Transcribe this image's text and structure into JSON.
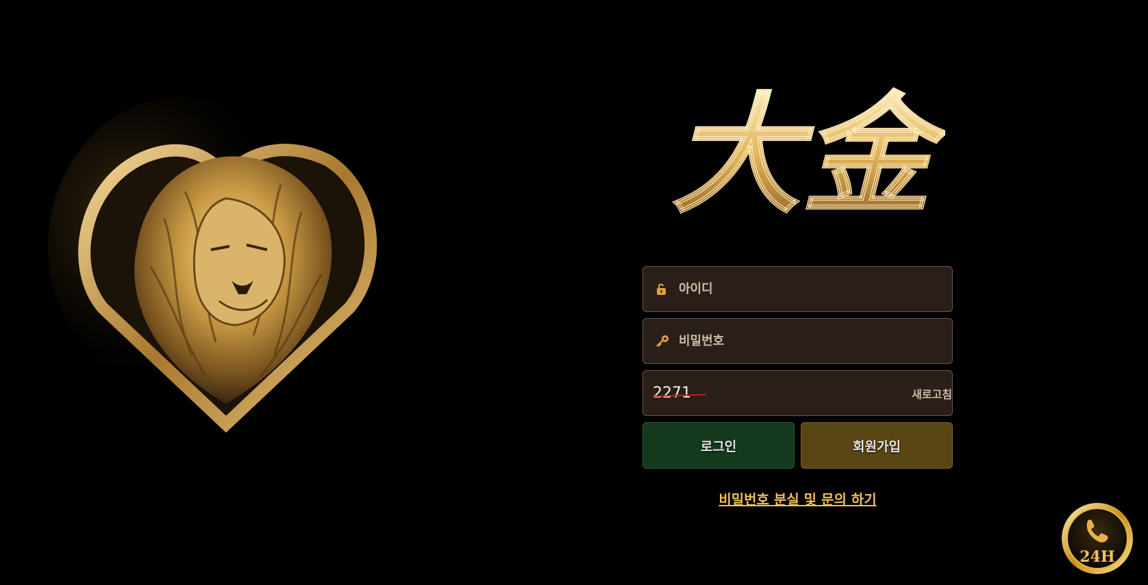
{
  "branding": {
    "logo_text": "大金",
    "badge_text": "24H"
  },
  "login": {
    "id_placeholder": "아이디",
    "password_placeholder": "비밀번호",
    "captcha_code": "2271",
    "captcha_refresh_label": "새로고침",
    "login_button_label": "로그인",
    "join_button_label": "회원가입",
    "forgot_link_label": "비밀번호 분실 및 문의 하기"
  },
  "icons": {
    "id_field": "unlock-icon",
    "password_field": "key-icon",
    "badge": "phone-icon"
  },
  "colors": {
    "background": "#000000",
    "field_bg": "#2a1f18",
    "login_button": "#14391d",
    "join_button": "#5a4514",
    "accent_gold": "#f0c05a"
  }
}
